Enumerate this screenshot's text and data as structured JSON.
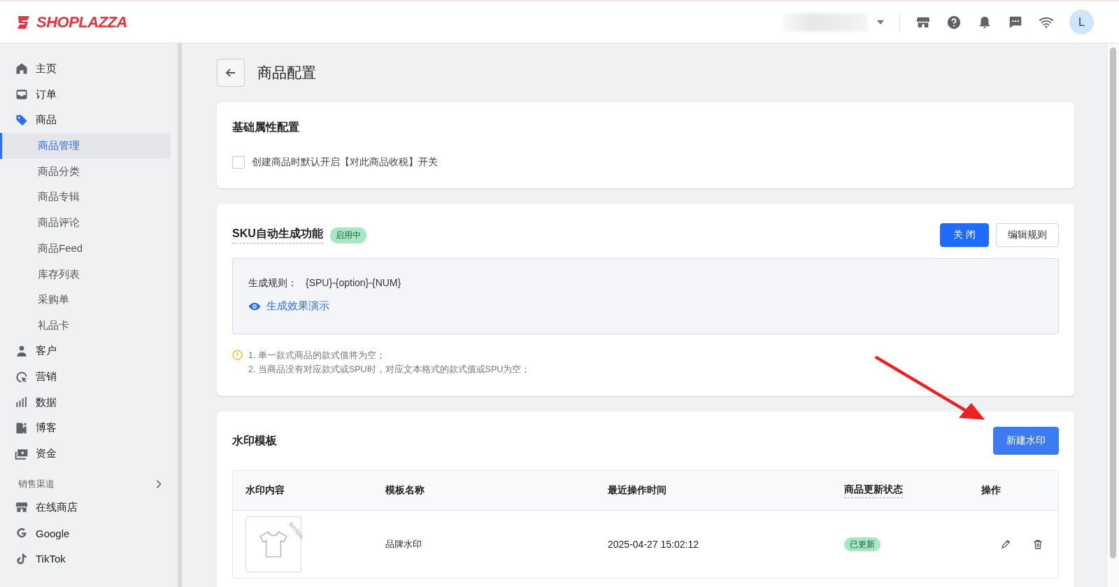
{
  "brand": {
    "name": "SHOPLAZZA"
  },
  "topbar": {
    "avatar": "L"
  },
  "sidebar": {
    "items": [
      {
        "label": "主页",
        "selected": false
      },
      {
        "label": "订单",
        "selected": false
      },
      {
        "label": "商品",
        "selected": false,
        "children": [
          {
            "label": "商品管理",
            "selected": true
          },
          {
            "label": "商品分类",
            "selected": false
          },
          {
            "label": "商品专辑",
            "selected": false
          },
          {
            "label": "商品评论",
            "selected": false
          },
          {
            "label": "商品Feed",
            "selected": false
          },
          {
            "label": "库存列表",
            "selected": false
          },
          {
            "label": "采购单",
            "selected": false
          },
          {
            "label": "礼品卡",
            "selected": false
          }
        ]
      },
      {
        "label": "客户",
        "selected": false
      },
      {
        "label": "营销",
        "selected": false
      },
      {
        "label": "数据",
        "selected": false
      },
      {
        "label": "博客",
        "selected": false
      },
      {
        "label": "资金",
        "selected": false
      }
    ],
    "channels_title": "销售渠道",
    "channels": [
      {
        "label": "在线商店",
        "selected": false
      },
      {
        "label": "Google",
        "selected": false
      },
      {
        "label": "TikTok",
        "selected": false
      }
    ]
  },
  "page": {
    "title": "商品配置"
  },
  "basic": {
    "title": "基础属性配置",
    "checkbox": {
      "label": "创建商品时默认开启【对此商品收税】开关",
      "checked": false
    }
  },
  "sku": {
    "title": "SKU自动生成功能",
    "status": "启用中",
    "enabled": true,
    "buttons": [
      "关 闭",
      "编辑规则"
    ],
    "rule_label": "生成规则：",
    "rule_value": "{SPU}-{option}-{NUM}",
    "demo_link": "生成效果演示",
    "notes": [
      "1. 单一款式商品的款式值将为空；",
      "2. 当商品没有对应款式或SPU时，对应文本格式的款式值或SPU为空；"
    ]
  },
  "watermark": {
    "title": "水印模板",
    "new_button": "新建水印",
    "table": {
      "columns": [
        "水印内容",
        "模板名称",
        "最近操作时间",
        "商品更新状态",
        "操作"
      ],
      "rows": [
        {
          "thumbnail_text": "terrible",
          "name": "品牌水印",
          "time": "2025-04-27 15:02:12",
          "status": "已更新",
          "updated": true
        }
      ]
    }
  }
}
